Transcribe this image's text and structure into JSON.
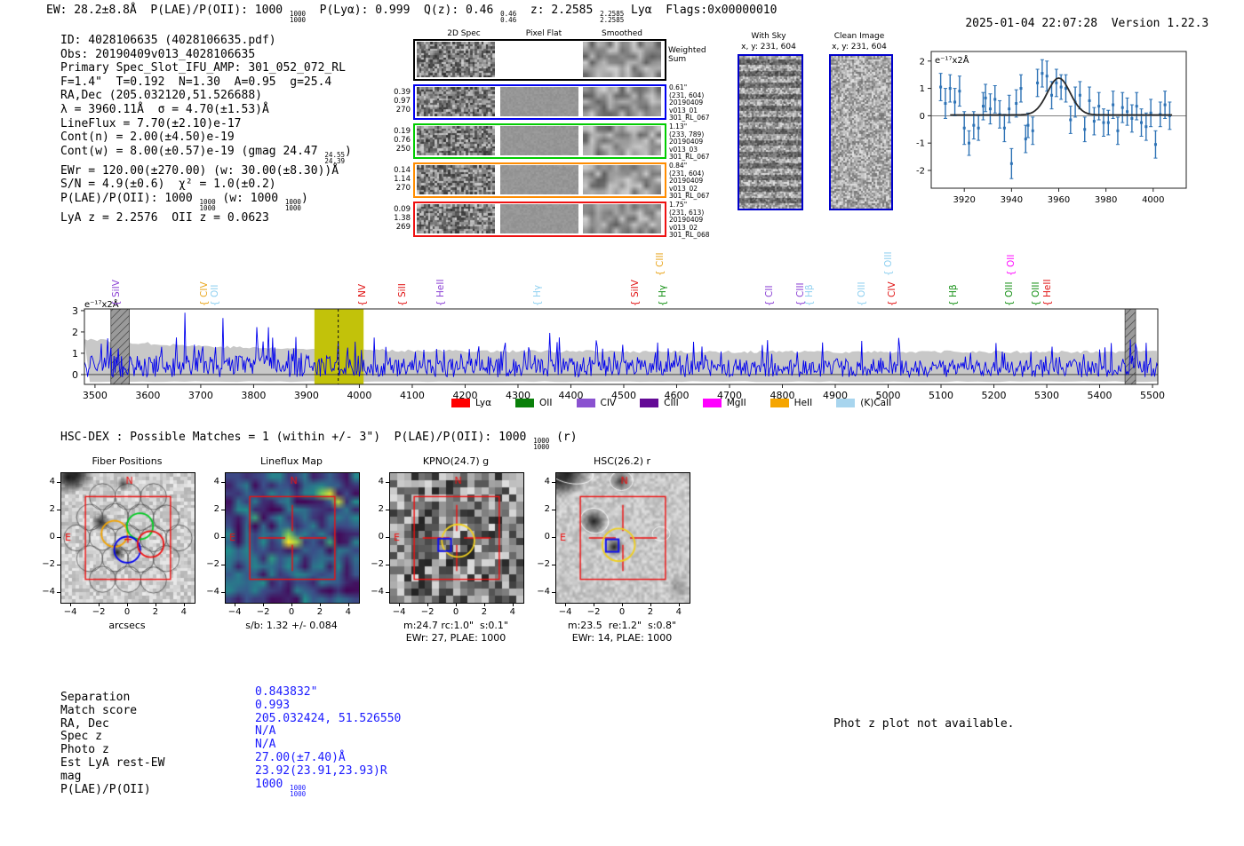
{
  "header": {
    "left_segments": [
      {
        "t": "EW: 28.2±8.8Å  P(LAE)/P(OII): 1000 "
      },
      {
        "f": [
          "1000",
          "1000"
        ]
      },
      {
        "t": "  P(Lyα): 0.999  Q(z): 0.46 "
      },
      {
        "f": [
          "0.46",
          "0.46"
        ]
      },
      {
        "t": "  z: 2.2585 "
      },
      {
        "f": [
          "2.2585",
          "2.2585"
        ]
      },
      {
        "t": " Lyα  Flags:0x00000010"
      }
    ],
    "datetime": "2025-01-04 22:07:28",
    "version": "Version 1.22.3"
  },
  "info_block": {
    "lines": [
      [
        {
          "t": "ID: 4028106635 (4028106635.pdf)"
        }
      ],
      [
        {
          "t": "Obs: 20190409v013_4028106635"
        }
      ],
      [
        {
          "t": "Primary Spec_Slot_IFU_AMP: 301_052_072_RL"
        }
      ],
      [
        {
          "t": "F=1.4\"  T=0.192  N=1.30  A=0.95  g=25.4"
        }
      ],
      [
        {
          "t": "RA,Dec (205.032120,51.526688)"
        }
      ],
      [
        {
          "t": "λ = 3960.11Å  σ = 4.70(±1.53)Å"
        }
      ],
      [
        {
          "t": "LineFlux = 7.70(±2.10)e-17"
        }
      ],
      [
        {
          "t": "Cont(n) = 2.00(±4.50)e-19"
        }
      ],
      [
        {
          "t": "Cont(w) = 8.00(±0.57)e-19 (gmag 24.47 "
        },
        {
          "f": [
            "24.55",
            "24.39"
          ]
        },
        {
          "t": ")"
        }
      ],
      [
        {
          "t": "EWr = 120.00(±270.00) (w: 30.00(±8.30))Å"
        }
      ],
      [
        {
          "t": "S/N = 4.9(±0.6)  χ² = 1.0(±0.2)"
        }
      ],
      [
        {
          "t": "P(LAE)/P(OII): 1000 "
        },
        {
          "f": [
            "1000",
            "1000"
          ]
        },
        {
          "t": " (w: 1000 "
        },
        {
          "f": [
            "1000",
            "1000"
          ]
        },
        {
          "t": ")"
        }
      ],
      [
        {
          "t": "LyA z = 2.2576  OII z = 0.0623"
        }
      ]
    ]
  },
  "spec2d": {
    "col_headers": [
      "2D Spec",
      "Pixel Flat",
      "Smoothed"
    ],
    "weighted_sum_label": "Weighted\nSum",
    "rows": [
      {
        "border": "#000000",
        "left": [],
        "right": []
      },
      {
        "border": "#0000ee",
        "left": [
          "0.39",
          "0.97",
          "270"
        ],
        "right": [
          "0.61\"",
          "(231, 604)",
          "20190409",
          "v013_01",
          "301_RL_067"
        ]
      },
      {
        "border": "#00cc00",
        "left": [
          "0.19",
          "0.76",
          "250"
        ],
        "right": [
          "1.13\"",
          "(233, 789)",
          "20190409",
          "v013_03",
          "301_RL_067"
        ]
      },
      {
        "border": "#ff8c00",
        "left": [
          "0.14",
          "1.14",
          "270"
        ],
        "right": [
          "0.84\"",
          "(231, 604)",
          "20190409",
          "v013_02",
          "301_RL_067"
        ]
      },
      {
        "border": "#ee1111",
        "left": [
          "0.09",
          "1.38",
          "269"
        ],
        "right": [
          "1.75\"",
          "(231, 613)",
          "20190409",
          "v013_02",
          "301_RL_068"
        ]
      }
    ]
  },
  "sky_panels": [
    {
      "title": "With Sky",
      "coords": "x, y: 231, 604"
    },
    {
      "title": "Clean Image",
      "coords": "x, y: 231, 604"
    }
  ],
  "chart_data": [
    {
      "name": "line_fit_inset",
      "type": "scatter",
      "ylabel": "e⁻¹⁷x2Å",
      "x_ticks": [
        3920,
        3940,
        3960,
        3980,
        4000
      ],
      "y_ticks": [
        -2,
        -1,
        0,
        1,
        2
      ],
      "xlim": [
        3906,
        4014
      ],
      "ylim": [
        -2.65,
        2.35
      ],
      "gaussian_fit": {
        "center": 3960,
        "sigma": 4.8,
        "amplitude": 1.35
      },
      "point_color": "#2d72b5",
      "points": [
        [
          3910,
          1.05,
          0.5
        ],
        [
          3912,
          0.45,
          0.55
        ],
        [
          3914,
          1.0,
          0.5
        ],
        [
          3916,
          0.5,
          0.5
        ],
        [
          3918,
          0.9,
          0.55
        ],
        [
          3920,
          -0.45,
          0.6
        ],
        [
          3922,
          -1.0,
          0.45
        ],
        [
          3924,
          -0.35,
          0.5
        ],
        [
          3926,
          -0.45,
          0.45
        ],
        [
          3928,
          0.35,
          0.5
        ],
        [
          3929,
          0.65,
          0.5
        ],
        [
          3931,
          0.25,
          0.55
        ],
        [
          3933,
          0.6,
          0.5
        ],
        [
          3935,
          0.05,
          0.5
        ],
        [
          3937,
          -0.45,
          0.5
        ],
        [
          3939,
          0.25,
          0.5
        ],
        [
          3940,
          -1.75,
          0.55
        ],
        [
          3942,
          0.45,
          0.5
        ],
        [
          3944,
          1.0,
          0.5
        ],
        [
          3946,
          -0.85,
          0.5
        ],
        [
          3947,
          -0.35,
          0.45
        ],
        [
          3949,
          -0.55,
          0.5
        ],
        [
          3951,
          1.2,
          0.5
        ],
        [
          3953,
          1.55,
          0.5
        ],
        [
          3955,
          1.45,
          0.55
        ],
        [
          3957,
          0.75,
          0.5
        ],
        [
          3959,
          1.2,
          0.5
        ],
        [
          3961,
          1.05,
          0.45
        ],
        [
          3963,
          1.0,
          0.5
        ],
        [
          3965,
          -0.15,
          0.5
        ],
        [
          3967,
          0.5,
          0.55
        ],
        [
          3969,
          0.75,
          0.5
        ],
        [
          3971,
          -0.5,
          0.45
        ],
        [
          3973,
          0.55,
          0.5
        ],
        [
          3975,
          -0.2,
          0.5
        ],
        [
          3977,
          0.35,
          0.5
        ],
        [
          3979,
          -0.25,
          0.5
        ],
        [
          3981,
          -0.25,
          0.45
        ],
        [
          3983,
          0.4,
          0.5
        ],
        [
          3985,
          -0.55,
          0.5
        ],
        [
          3987,
          0.3,
          0.55
        ],
        [
          3989,
          0.15,
          0.5
        ],
        [
          3991,
          -0.1,
          0.5
        ],
        [
          3993,
          0.35,
          0.5
        ],
        [
          3995,
          -0.25,
          0.5
        ],
        [
          3997,
          -0.4,
          0.5
        ],
        [
          3999,
          0.1,
          0.5
        ],
        [
          4001,
          -1.05,
          0.5
        ],
        [
          4003,
          0.05,
          0.45
        ],
        [
          4005,
          0.4,
          0.5
        ],
        [
          4007,
          0.0,
          0.5
        ]
      ]
    },
    {
      "name": "full_spectrum",
      "type": "line",
      "ylabel": "e⁻¹⁷x2Å",
      "x_ticks": [
        3500,
        3600,
        3700,
        3800,
        3900,
        4000,
        4100,
        4200,
        4300,
        4400,
        4500,
        4600,
        4700,
        4800,
        4900,
        5000,
        5100,
        5200,
        5300,
        5400,
        5500
      ],
      "y_ticks": [
        0,
        1,
        2,
        3
      ],
      "xlim": [
        3480,
        5510
      ],
      "ylim": [
        -0.46,
        3.08
      ],
      "line_color": "#0000ee",
      "band_color": "#c8c8c8",
      "highlight_region": {
        "x0": 3915,
        "x1": 4008,
        "color": "#c2c20a",
        "line_x": 3960
      },
      "masked_regions": [
        {
          "x0": 3530,
          "x1": 3565
        },
        {
          "x0": 5448,
          "x1": 5468
        }
      ],
      "noise_seed": 77,
      "spikes": [
        [
          3670,
          2.9
        ],
        [
          3742,
          2.65
        ],
        [
          3960,
          1.55
        ]
      ],
      "emission_labels_lower": [
        {
          "text": "SiIV",
          "wavelength": 3560,
          "color": "#8a3fd4"
        },
        {
          "text": "CIV",
          "wavelength": 3727,
          "color": "#e9a61e"
        },
        {
          "text": "OII",
          "wavelength": 3748,
          "color": "#8fd0f0"
        },
        {
          "text": "NV",
          "wavelength": 4026,
          "color": "#e01212"
        },
        {
          "text": "SiII",
          "wavelength": 4102,
          "color": "#e01212"
        },
        {
          "text": "HeII",
          "wavelength": 4174,
          "color": "#8a3fd4"
        },
        {
          "text": "Hγ",
          "wavelength": 4357,
          "color": "#8fd0f0"
        },
        {
          "text": "SiIV",
          "wavelength": 4542,
          "color": "#e01212"
        },
        {
          "text": "Hγ",
          "wavelength": 4594,
          "color": "#159015"
        },
        {
          "text": "CII",
          "wavelength": 4796,
          "color": "#8a3fd4"
        },
        {
          "text": "CIII",
          "wavelength": 4855,
          "color": "#8a3fd4"
        },
        {
          "text": "Hβ",
          "wavelength": 4872,
          "color": "#8fd0f0"
        },
        {
          "text": "OIII",
          "wavelength": 4971,
          "color": "#8fd0f0"
        },
        {
          "text": "CIV",
          "wavelength": 5028,
          "color": "#e01212"
        },
        {
          "text": "Hβ",
          "wavelength": 5144,
          "color": "#159015"
        },
        {
          "text": "OIII",
          "wavelength": 5250,
          "color": "#159015"
        },
        {
          "text": "OIII",
          "wavelength": 5300,
          "color": "#159015"
        },
        {
          "text": "HeII",
          "wavelength": 5322,
          "color": "#e01212"
        }
      ],
      "emission_labels_upper": [
        {
          "text": "CIII",
          "wavelength": 4589,
          "color": "#e9a61e"
        },
        {
          "text": "OIII",
          "wavelength": 5021,
          "color": "#8fd0f0"
        },
        {
          "text": "OII",
          "wavelength": 5253,
          "color": "#ff10ff"
        }
      ],
      "legend": [
        {
          "label": "Lyα",
          "color": "#ff0000"
        },
        {
          "label": "OII",
          "color": "#0a800a"
        },
        {
          "label": "CIV",
          "color": "#8a52d0"
        },
        {
          "label": "CIII",
          "color": "#640a96"
        },
        {
          "label": "MgII",
          "color": "#ff00ff"
        },
        {
          "label": "HeII",
          "color": "#f5a500"
        },
        {
          "label": "(K)CaII",
          "color": "#a8d5ee"
        }
      ]
    }
  ],
  "hsc_dex": {
    "segments": [
      {
        "t": "HSC-DEX : Possible Matches = 1 (within +/- 3\")  P(LAE)/P(OII): 1000 "
      },
      {
        "f": [
          "1000",
          "1000"
        ]
      },
      {
        "t": " (r)"
      }
    ]
  },
  "cutouts": {
    "axis_ticks": [
      -4,
      -2,
      0,
      2,
      4
    ],
    "compass": {
      "north": "N",
      "east": "E"
    },
    "panels": [
      {
        "type": "fiber",
        "title": "Fiber Positions",
        "xlabel": "arcsecs",
        "captions": []
      },
      {
        "type": "lineflux",
        "title": "Lineflux Map",
        "xlabel": "",
        "captions": [
          "s/b: 1.32 +/- 0.084"
        ]
      },
      {
        "type": "kpno",
        "title": "KPNO(24.7) g",
        "xlabel": "",
        "captions": [
          "m:24.7 rc:1.0\"  s:0.1\"",
          "EWr: 27, PLAE: 1000"
        ]
      },
      {
        "type": "hsc",
        "title": "HSC(26.2) r",
        "xlabel": "",
        "captions": [
          "m:23.5  re:1.2\"  s:0.8\"",
          "EWr: 14, PLAE: 1000"
        ]
      }
    ]
  },
  "match_table": {
    "rows": [
      {
        "label": "Separation",
        "value_segments": [
          {
            "t": "0.843832\""
          }
        ]
      },
      {
        "label": "Match score",
        "value_segments": [
          {
            "t": "0.993"
          }
        ]
      },
      {
        "label": "RA, Dec",
        "value_segments": [
          {
            "t": "205.032424, 51.526550"
          }
        ]
      },
      {
        "label": "Spec z",
        "value_segments": [
          {
            "t": "N/A"
          }
        ]
      },
      {
        "label": "Photo z",
        "value_segments": [
          {
            "t": "N/A"
          }
        ]
      },
      {
        "label": "Est LyA rest-EW",
        "value_segments": [
          {
            "t": "27.00(±7.40)Å"
          }
        ]
      },
      {
        "label": "mag",
        "value_segments": [
          {
            "t": "23.92(23.91,23.93)R"
          }
        ]
      },
      {
        "label": "P(LAE)/P(OII)",
        "value_segments": [
          {
            "t": "1000 "
          },
          {
            "f": [
              "1000",
              "1000"
            ]
          }
        ]
      }
    ]
  },
  "photz_note": "Phot z plot not available."
}
